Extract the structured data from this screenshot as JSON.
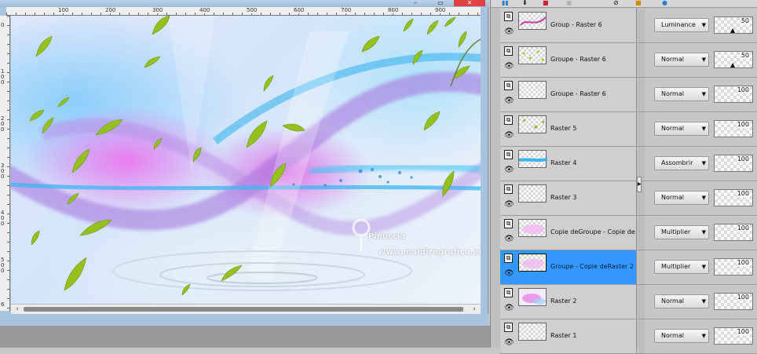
{
  "document": {
    "title": "",
    "ruler_h": [
      "100",
      "200",
      "300",
      "400",
      "500",
      "600",
      "700",
      "800",
      "900"
    ],
    "ruler_v": [
      "0",
      "1 0 0",
      "2 0 0",
      "3 0 0",
      "4 0 0",
      "5 0 0",
      "6"
    ],
    "watermark_name": "Pinuccia",
    "watermark_url": "www.maidiregrafica.eu",
    "scroll_left_icon": "‹",
    "scroll_right_icon": "›"
  },
  "window_buttons": {
    "minimize": "–",
    "restore": "▭",
    "close": "✕"
  },
  "layers": [
    {
      "name": "Group - Raster 6",
      "blend": "Luminance",
      "opacity": "50",
      "has_slider": true,
      "selected": false,
      "thumb": "pink-curve"
    },
    {
      "name": "Groupe -  Raster 6",
      "blend": "Normal",
      "opacity": "50",
      "has_slider": true,
      "selected": false,
      "thumb": "dots"
    },
    {
      "name": "Groupe - Raster 6",
      "blend": "Normal",
      "opacity": "100",
      "has_slider": false,
      "selected": false,
      "thumb": "blank"
    },
    {
      "name": "Raster 5",
      "blend": "Normal",
      "opacity": "100",
      "has_slider": false,
      "selected": false,
      "thumb": "leaves"
    },
    {
      "name": "Raster 4",
      "blend": "Assombrir",
      "opacity": "100",
      "has_slider": false,
      "selected": false,
      "thumb": "blue-band"
    },
    {
      "name": "Raster 3",
      "blend": "Normal",
      "opacity": "100",
      "has_slider": false,
      "selected": false,
      "thumb": "blank"
    },
    {
      "name": "Copie deGroupe - Copie deR",
      "blend": "Multiplier",
      "opacity": "100",
      "has_slider": false,
      "selected": false,
      "thumb": "pink-soft"
    },
    {
      "name": "Groupe - Copie deRaster 2",
      "blend": "Multiplier",
      "opacity": "100",
      "has_slider": false,
      "selected": true,
      "thumb": "pink-soft"
    },
    {
      "name": "Raster 2",
      "blend": "Normal",
      "opacity": "100",
      "has_slider": false,
      "selected": false,
      "thumb": "pink-cloud"
    },
    {
      "name": "Raster 1",
      "blend": "Normal",
      "opacity": "100",
      "has_slider": false,
      "selected": false,
      "thumb": "blank"
    }
  ],
  "colors": {
    "selected_row": "#3399ff",
    "leaf_green": "#8fbf1e",
    "ribbon_purple": "#9a63d8",
    "ribbon_blue": "#2fb7ef"
  },
  "icons": {
    "group": "group-icon",
    "visibility": "eye-icon",
    "dropdown": "chevron-down-icon"
  }
}
